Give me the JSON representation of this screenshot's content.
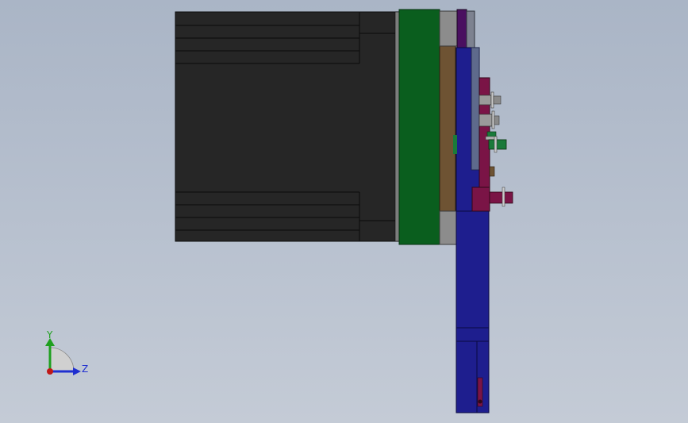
{
  "viewport": {
    "background_top": "#aab5c6",
    "background_bottom": "#c4cbd6"
  },
  "colors": {
    "motor_body": "#262626",
    "motor_edge": "#0c0c0c",
    "pcb_green": "#0a5e1e",
    "adapter_brown": "#6e5333",
    "bracket_blue": "#1e1e8e",
    "accent_purple": "#7a1446",
    "bearing_gray": "#8c8c8c",
    "fastener_green": "#1a7a3a"
  },
  "triad": {
    "y_label": "Y",
    "z_label": "Z",
    "y_color": "#1fa01f",
    "z_color": "#1f2fd0",
    "origin_color": "#c01818"
  }
}
